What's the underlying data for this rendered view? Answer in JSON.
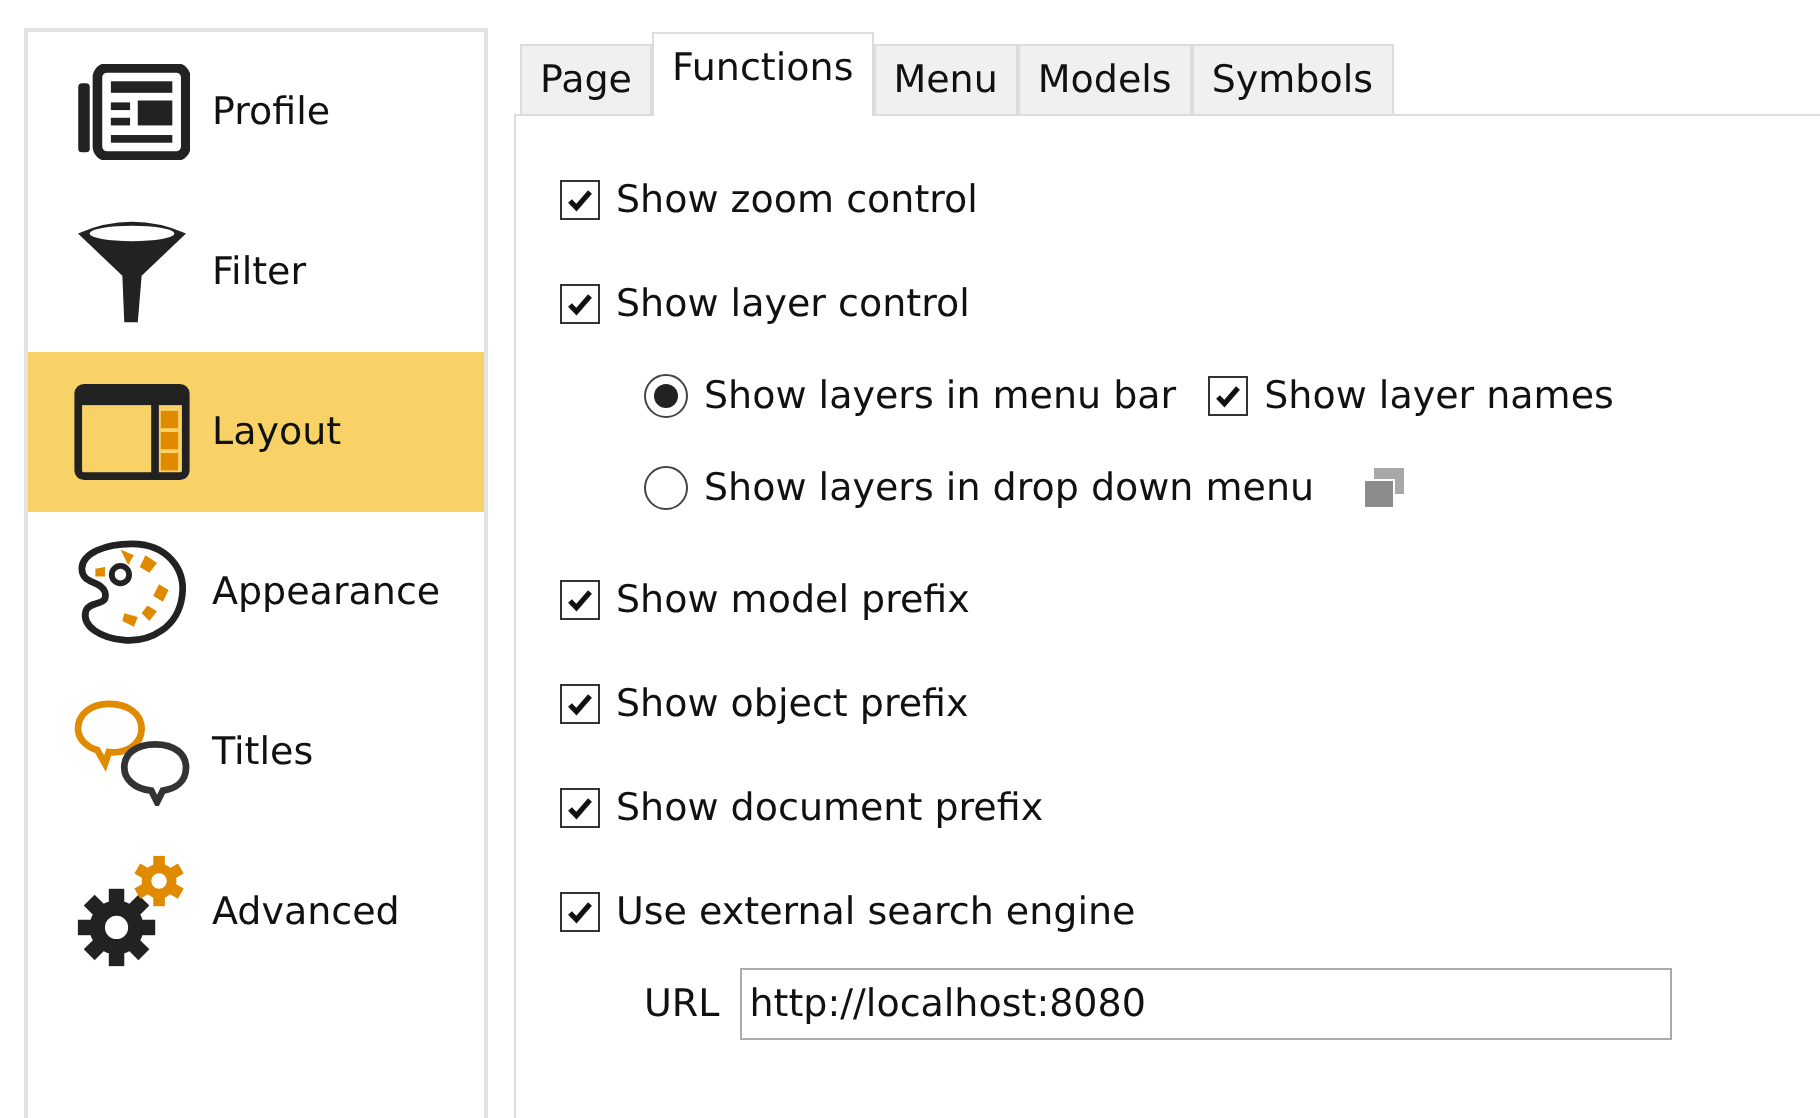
{
  "sidebar": {
    "items": [
      {
        "label": "Profile",
        "selected": false
      },
      {
        "label": "Filter",
        "selected": false
      },
      {
        "label": "Layout",
        "selected": true
      },
      {
        "label": "Appearance",
        "selected": false
      },
      {
        "label": "Titles",
        "selected": false
      },
      {
        "label": "Advanced",
        "selected": false
      }
    ]
  },
  "tabs": [
    {
      "label": "Page",
      "selected": false
    },
    {
      "label": "Functions",
      "selected": true
    },
    {
      "label": "Menu",
      "selected": false
    },
    {
      "label": "Models",
      "selected": false
    },
    {
      "label": "Symbols",
      "selected": false
    }
  ],
  "options": [
    {
      "kind": "checkbox",
      "label": "Show zoom control",
      "checked": true
    },
    {
      "kind": "checkbox",
      "label": "Show layer control",
      "checked": true,
      "children": [
        {
          "kind": "radio",
          "label": "Show layers in menu bar",
          "selected": true,
          "trailing": {
            "kind": "checkbox",
            "label": "Show layer names",
            "checked": true
          }
        },
        {
          "kind": "radio",
          "label": "Show layers in drop down menu",
          "selected": false,
          "trailing": {
            "kind": "icon"
          }
        }
      ]
    },
    {
      "kind": "checkbox",
      "label": "Show model prefix",
      "checked": true
    },
    {
      "kind": "checkbox",
      "label": "Show object prefix",
      "checked": true
    },
    {
      "kind": "checkbox",
      "label": "Show document prefix",
      "checked": true
    },
    {
      "kind": "checkbox",
      "label": "Use external search engine",
      "checked": true,
      "children": [
        {
          "kind": "field",
          "label": "URL",
          "value": "http://localhost:8080"
        }
      ]
    }
  ]
}
